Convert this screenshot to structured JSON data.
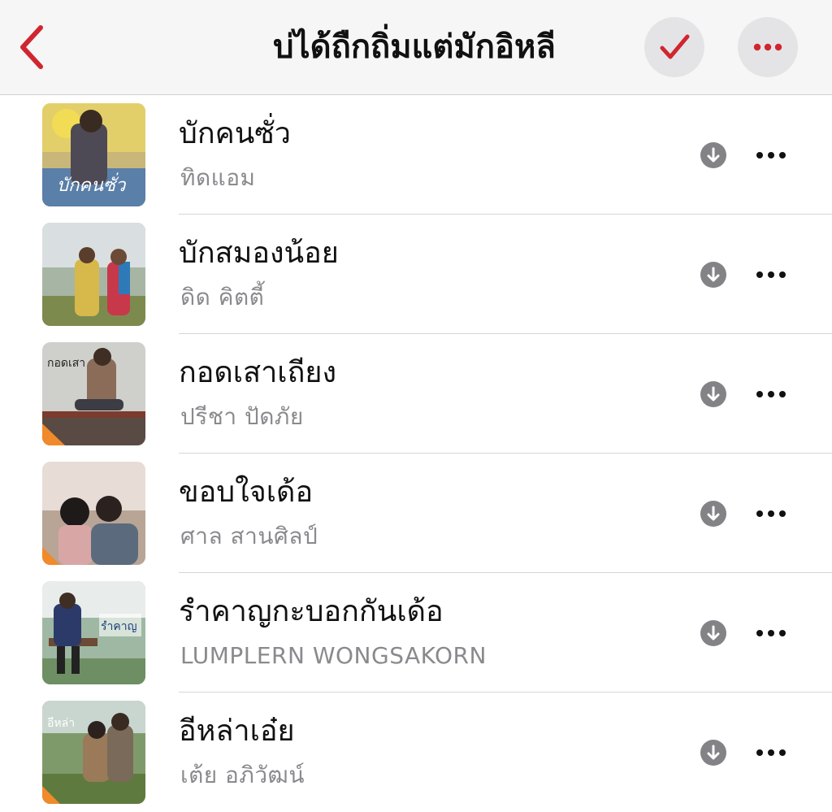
{
  "header": {
    "title": "บ่ได้ถืกถิ่มแต่มักอิหลี",
    "accent_color": "#d0262f",
    "back_icon": "chevron-left-icon",
    "check_icon": "checkmark-icon",
    "more_icon": "ellipsis-icon"
  },
  "songs": [
    {
      "title": "บักคนซั่ว",
      "artist": "ทิดแอม"
    },
    {
      "title": "บักสมองน้อย",
      "artist": "ดิด คิตตี้"
    },
    {
      "title": "กอดเสาเถียง",
      "artist": "ปรีชา ปัดภัย"
    },
    {
      "title": "ขอบใจเด้อ",
      "artist": "ศาล สานศิลป์"
    },
    {
      "title": "รำคาญกะบอกกันเด้อ",
      "artist": "LUMPLERN WONGSAKORN"
    },
    {
      "title": "อีหล่าเอ๋ย",
      "artist": "เต้ย อภิวัฒน์"
    }
  ]
}
